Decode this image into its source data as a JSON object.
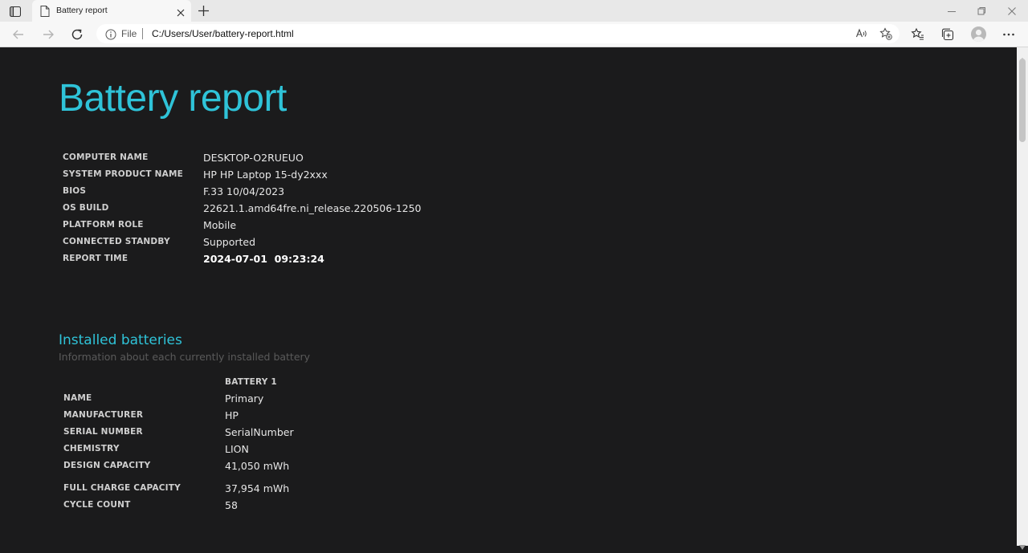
{
  "browser": {
    "tab_title": "Battery report",
    "scheme_label": "File",
    "url": "C:/Users/User/battery-report.html"
  },
  "colors": {
    "accent": "#2fc3d8",
    "page_bg": "#1b1b1c"
  },
  "icons": {
    "tab_actions": "tab-actions-icon",
    "page": "page-icon",
    "close": "close-icon",
    "new_tab": "plus-icon",
    "back": "back-arrow-icon",
    "forward": "forward-arrow-icon",
    "refresh": "refresh-icon",
    "info": "info-icon",
    "read_aloud": "read-aloud-icon",
    "favorite": "star-plus-icon",
    "favorites": "favorites-icon",
    "collections": "collections-icon",
    "profile": "avatar-icon",
    "more": "more-icon"
  },
  "report": {
    "title": "Battery report",
    "system_info": [
      {
        "label": "COMPUTER NAME",
        "value": "DESKTOP-O2RUEUO"
      },
      {
        "label": "SYSTEM PRODUCT NAME",
        "value": "HP HP Laptop 15-dy2xxx"
      },
      {
        "label": "BIOS",
        "value": "F.33 10/04/2023"
      },
      {
        "label": "OS BUILD",
        "value": "22621.1.amd64fre.ni_release.220506-1250"
      },
      {
        "label": "PLATFORM ROLE",
        "value": "Mobile"
      },
      {
        "label": "CONNECTED STANDBY",
        "value": "Supported"
      },
      {
        "label": "REPORT TIME",
        "value": "2024-07-01  09:23:24"
      }
    ],
    "installed_batteries": {
      "heading": "Installed batteries",
      "subheading": "Information about each currently installed battery",
      "column_header": "BATTERY 1",
      "rows": [
        {
          "label": "NAME",
          "value": "Primary"
        },
        {
          "label": "MANUFACTURER",
          "value": "HP"
        },
        {
          "label": "SERIAL NUMBER",
          "value": "SerialNumber"
        },
        {
          "label": "CHEMISTRY",
          "value": "LION"
        },
        {
          "label": "DESIGN CAPACITY",
          "value": "41,050 mWh"
        },
        {
          "label": "FULL CHARGE CAPACITY",
          "value": "37,954 mWh"
        },
        {
          "label": "CYCLE COUNT",
          "value": "58"
        }
      ]
    }
  }
}
